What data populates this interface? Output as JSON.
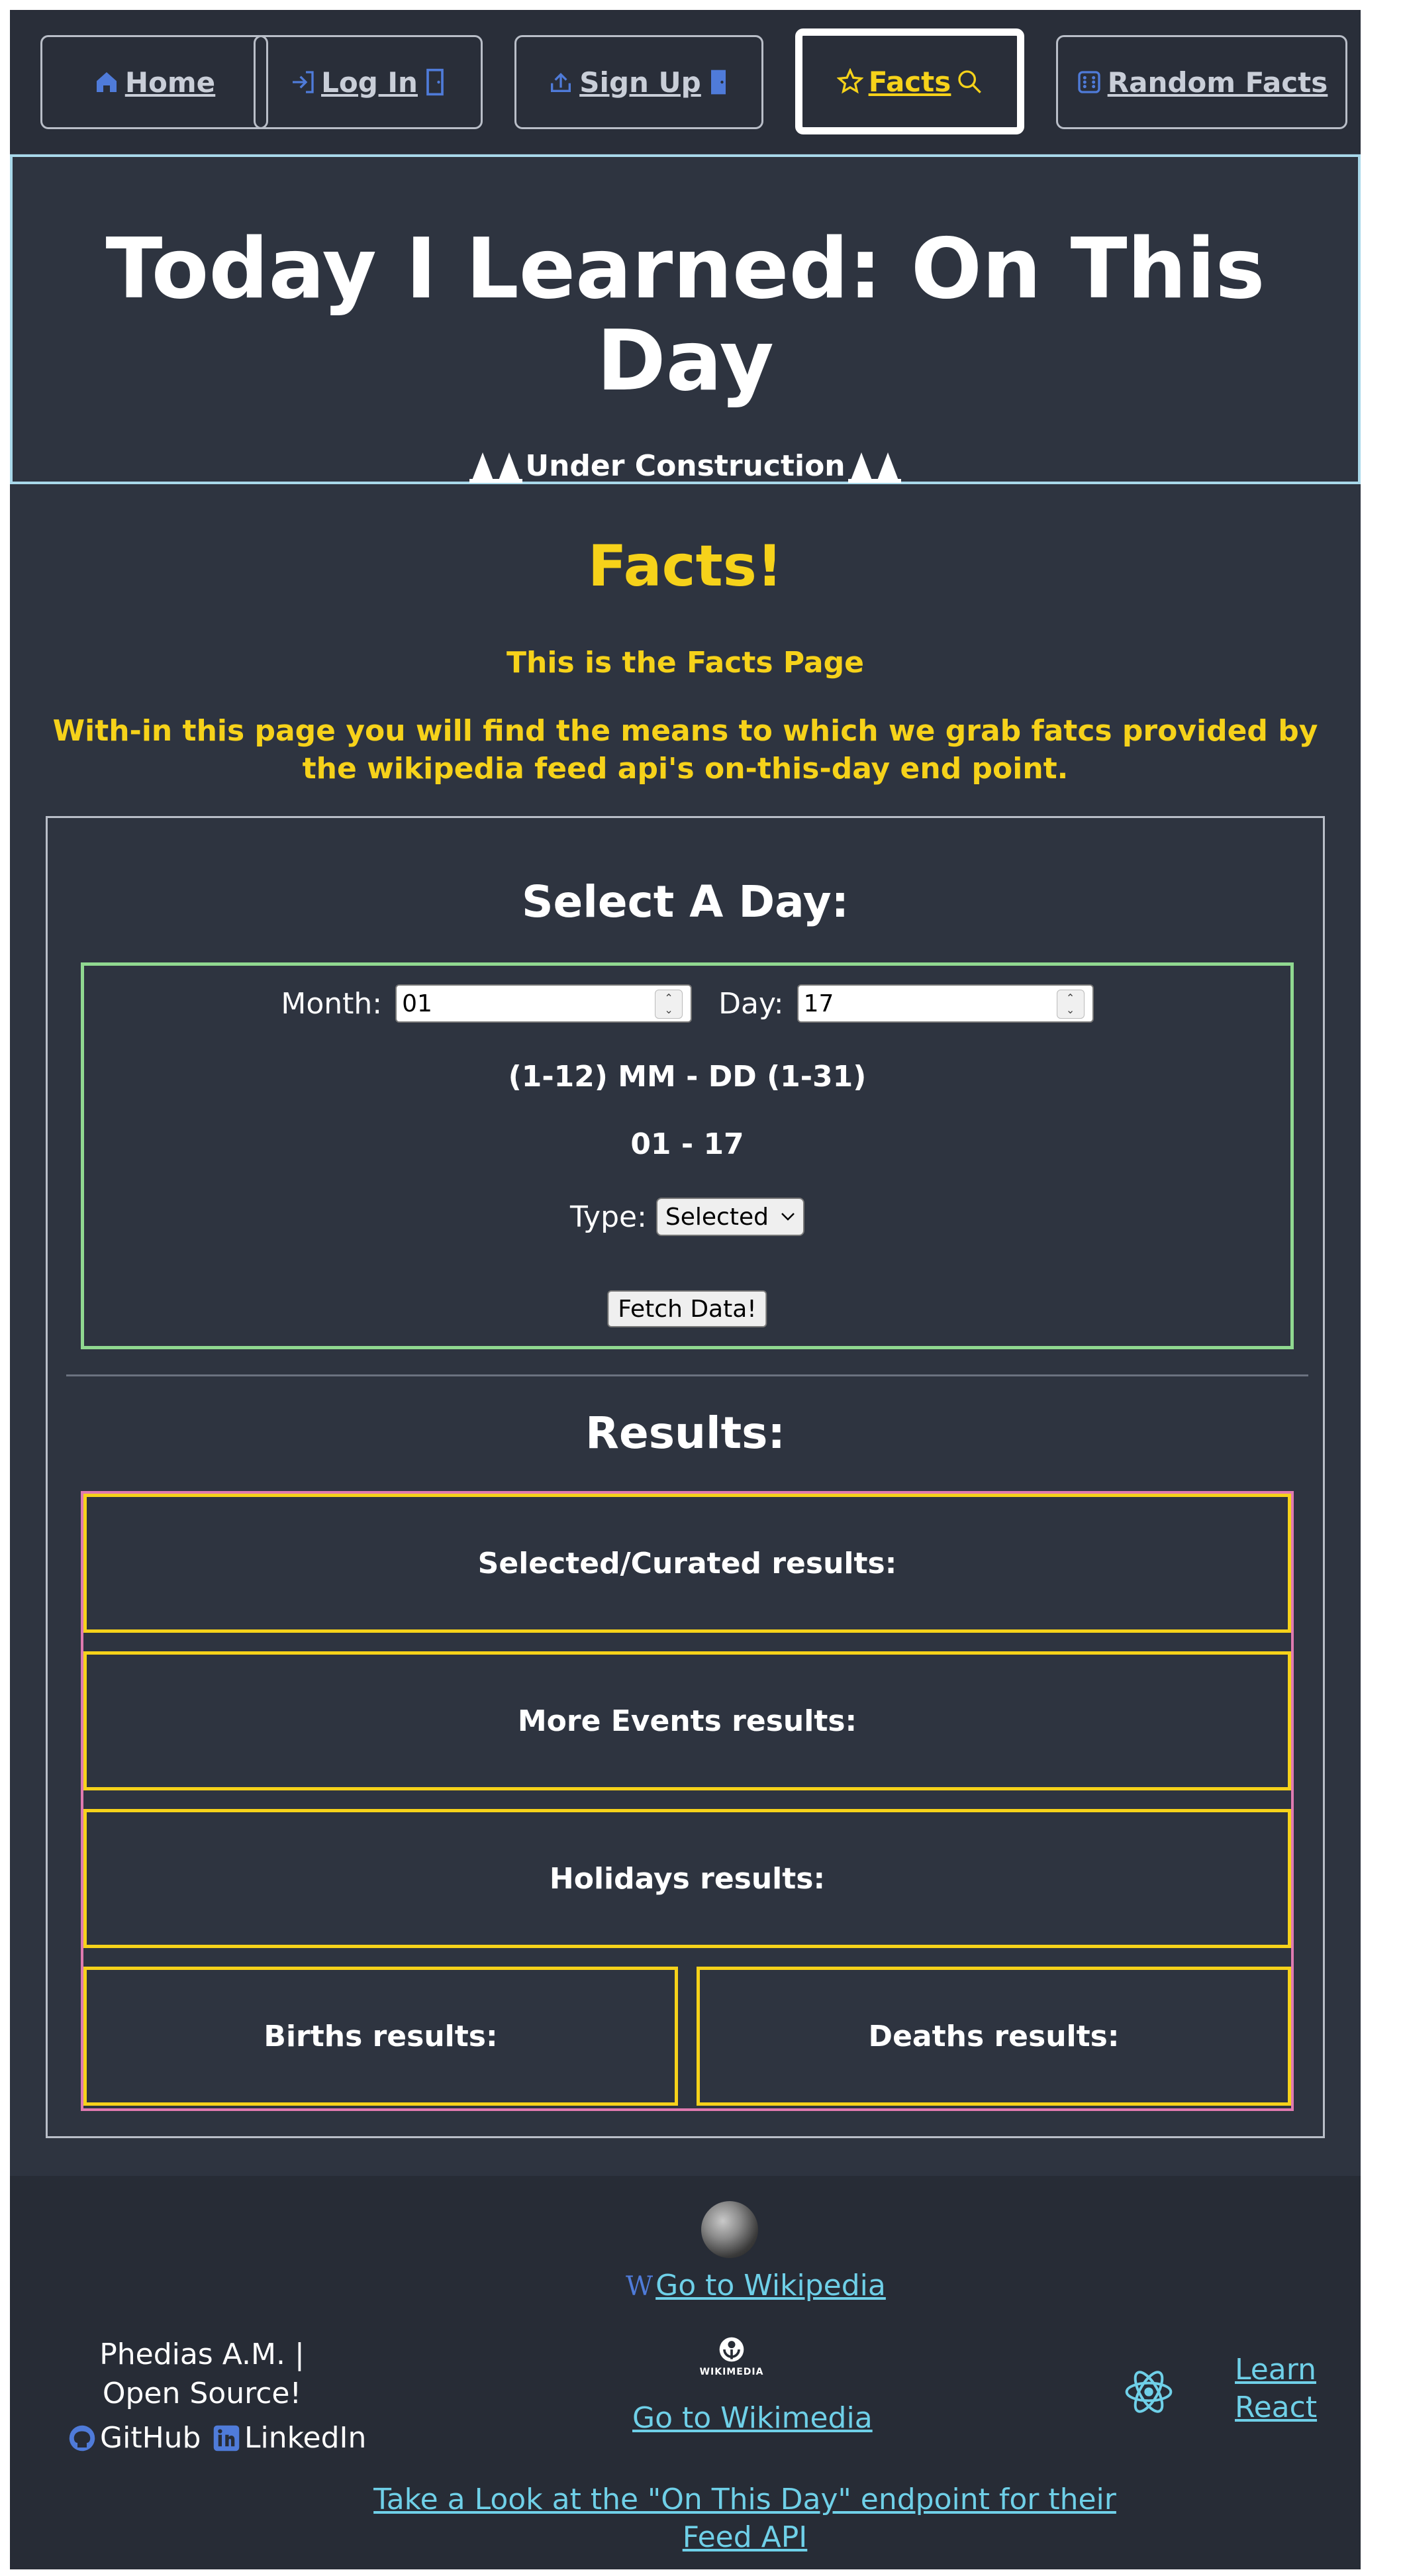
{
  "nav": {
    "home": "Home",
    "login": "Log In",
    "signup": "Sign Up",
    "facts": "Facts",
    "random": "Random Facts"
  },
  "hero": {
    "title": "Today I Learned: On This Day",
    "construction": "Under Construction"
  },
  "facts": {
    "title": "Facts!",
    "subtitle": "This is the Facts Page",
    "description": "With-in this page you will find the means to which we grab fatcs provided by the wikipedia feed api's on-this-day end point."
  },
  "form": {
    "title": "Select A Day:",
    "month_label": "Month:",
    "month_value": "01",
    "day_label": "Day:",
    "day_value": "17",
    "range_label": "(1-12) MM - DD (1-31)",
    "date_display": "01 - 17",
    "type_label": "Type:",
    "type_value": "Selected",
    "fetch_label": "Fetch Data!"
  },
  "results": {
    "title": "Results:",
    "selected": "Selected/Curated results:",
    "events": "More Events results:",
    "holidays": "Holidays results:",
    "births": "Births results:",
    "deaths": "Deaths results:"
  },
  "footer": {
    "wikipedia_link": "Go to Wikipedia",
    "wikimedia_link": "Go to Wikimedia",
    "wikimedia_logo_text": "WIKIMEDIA",
    "credit": "Phedias A.M. | Open Source!",
    "github": "GitHub",
    "linkedin": "LinkedIn",
    "learn_react": "Learn React",
    "endpoint_link": "Take a Look at the \"On This Day\" endpoint for their Feed API"
  },
  "colors": {
    "background": "#2e3440",
    "nav_background": "#292e39",
    "accent_yellow": "#f6d21a",
    "link_cyan": "#6fd0e8",
    "icon_blue": "#4f7bd9"
  }
}
